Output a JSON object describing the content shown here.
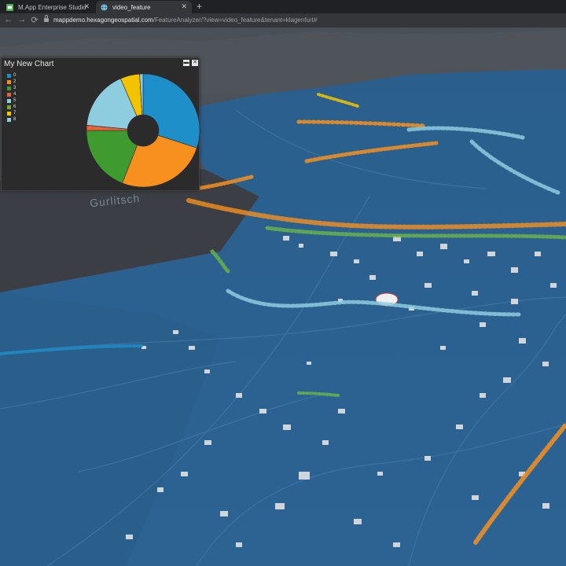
{
  "browser": {
    "tabs": [
      {
        "title": "M.App Enterprise Studio",
        "active": false
      },
      {
        "title": "video_feature",
        "active": true
      }
    ],
    "url": {
      "host": "mappdemo.hexagongeospatial.com",
      "path": "/FeatureAnalyzer/?view=video_feature&tenant=klagenfurt#"
    }
  },
  "map": {
    "place_label": "Gurlitsch"
  },
  "chart": {
    "title": "My New Chart",
    "legend": [
      "0",
      "2",
      "3",
      "4",
      "5",
      "6",
      "7",
      "8"
    ]
  },
  "chart_data": {
    "type": "pie",
    "title": "My New Chart",
    "categories": [
      "0",
      "2",
      "3",
      "4",
      "5",
      "6",
      "7",
      "8"
    ],
    "values": [
      30,
      26,
      19,
      1.5,
      17,
      0,
      5.5,
      1
    ],
    "colors": [
      "#1f8fc9",
      "#f7901e",
      "#3f9a2f",
      "#e8613a",
      "#8ecde0",
      "#7aa832",
      "#f3c300",
      "#8fc8d8"
    ],
    "donut": true
  }
}
